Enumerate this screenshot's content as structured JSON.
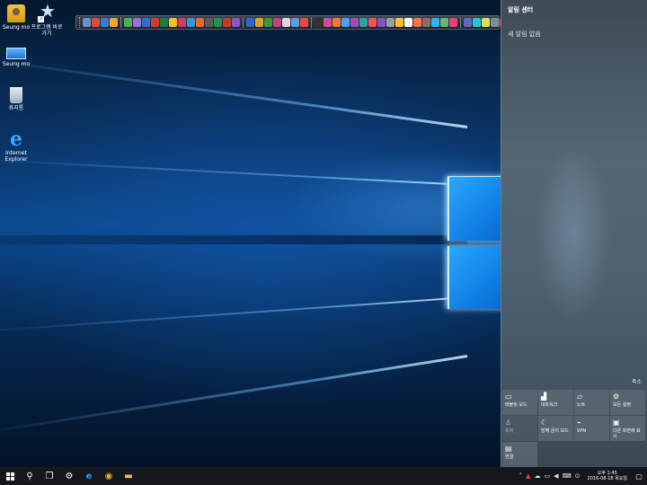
{
  "desktop": {
    "icons": [
      {
        "label": "Seung mo",
        "icon": "user-folder-icon"
      },
      {
        "label": "프로그램 바로가기",
        "icon": "program-shortcut-icon"
      },
      {
        "label": "Seung mo",
        "icon": "this-pc-icon"
      },
      {
        "label": "휴지통",
        "icon": "recycle-bin-icon"
      },
      {
        "label": "Internet Explorer",
        "icon": "internet-explorer-icon"
      }
    ]
  },
  "toolbar": {
    "icon_colors": [
      "#6d8fc7",
      "#e04a3a",
      "#2f80d0",
      "#f2a72b",
      "#4cae4c",
      "#9a6fd1",
      "#2d6fd1",
      "#d33a2c",
      "#1e7b3c",
      "#f0c21b",
      "#cf3b6e",
      "#2f9bd7",
      "#e66a1f",
      "#5a5a5a",
      "#2c8c4c",
      "#c23b2a",
      "#8a56c2",
      "#2a6bd1",
      "#e0a020",
      "#3a9a3a",
      "#c83a8c",
      "#d9d9d9",
      "#5d9be0",
      "#e84b3c",
      "#333333",
      "#d24b9b",
      "#f07a2a",
      "#42a5f5",
      "#ab47bc",
      "#26a69a",
      "#ef5350",
      "#7e57c2",
      "#9e9e9e",
      "#fbc02d",
      "#ffffff",
      "#ff7043",
      "#8d6e63",
      "#29b6f6",
      "#66bb6a",
      "#ec407a",
      "#5c6bc0",
      "#26c6da",
      "#d4e157",
      "#78909c",
      "#e53935",
      "#43a047",
      "#fb8c00",
      "#1e88e5",
      "#8e24aa",
      "#00acc1",
      "#b0bec5",
      "#90caf9",
      "#cfd8dc",
      "#a5d6a7"
    ]
  },
  "action_center": {
    "title": "알림 센터",
    "empty_message": "새 알림 없음",
    "collapse_label": "축소",
    "tiles": [
      {
        "label": "태블릿 모드",
        "icon": "tablet-mode-icon",
        "symbol": "▭",
        "enabled": true
      },
      {
        "label": "네트워크",
        "icon": "network-icon",
        "symbol": "▟",
        "enabled": true
      },
      {
        "label": "노트",
        "icon": "note-icon",
        "symbol": "▱",
        "enabled": true
      },
      {
        "label": "모든 설정",
        "icon": "settings-gear-icon",
        "symbol": "⚙",
        "enabled": true
      },
      {
        "label": "위치",
        "icon": "location-icon",
        "symbol": "♙",
        "enabled": false
      },
      {
        "label": "방해 금지 모드",
        "icon": "quiet-hours-moon-icon",
        "symbol": "☾",
        "enabled": true
      },
      {
        "label": "VPN",
        "icon": "vpn-icon",
        "symbol": "⌁",
        "enabled": true
      },
      {
        "label": "다른 화면에 표시",
        "icon": "project-display-icon",
        "symbol": "▣",
        "enabled": true
      },
      {
        "label": "연결",
        "icon": "connect-icon",
        "symbol": "▤",
        "enabled": true
      }
    ]
  },
  "taskbar": {
    "start_icon": "windows-start-icon",
    "search_symbol": "⚲",
    "taskview_symbol": "❐",
    "pinned": [
      {
        "icon": "settings-gear-icon",
        "symbol": "⚙",
        "color": "#ffffff"
      },
      {
        "icon": "edge-icon",
        "symbol": "e",
        "color": "#3c9bff"
      },
      {
        "icon": "chrome-icon",
        "symbol": "◉",
        "color": "#e9b82a"
      },
      {
        "icon": "file-explorer-icon",
        "symbol": "▬",
        "color": "#f2c24e"
      }
    ],
    "tray": [
      {
        "icon": "chevron-up-icon",
        "symbol": "˄"
      },
      {
        "icon": "security-alert-icon",
        "symbol": "▲"
      },
      {
        "icon": "onedrive-icon",
        "symbol": "☁"
      },
      {
        "icon": "network-monitor-icon",
        "symbol": "▭"
      },
      {
        "icon": "volume-icon",
        "symbol": "◀"
      },
      {
        "icon": "keyboard-icon",
        "symbol": "⌨"
      },
      {
        "icon": "language-icon",
        "symbol": "⊙"
      }
    ],
    "clock_time": "오후 1:45",
    "clock_date": "2016-08-18 목요일",
    "notification_symbol": "▢"
  }
}
